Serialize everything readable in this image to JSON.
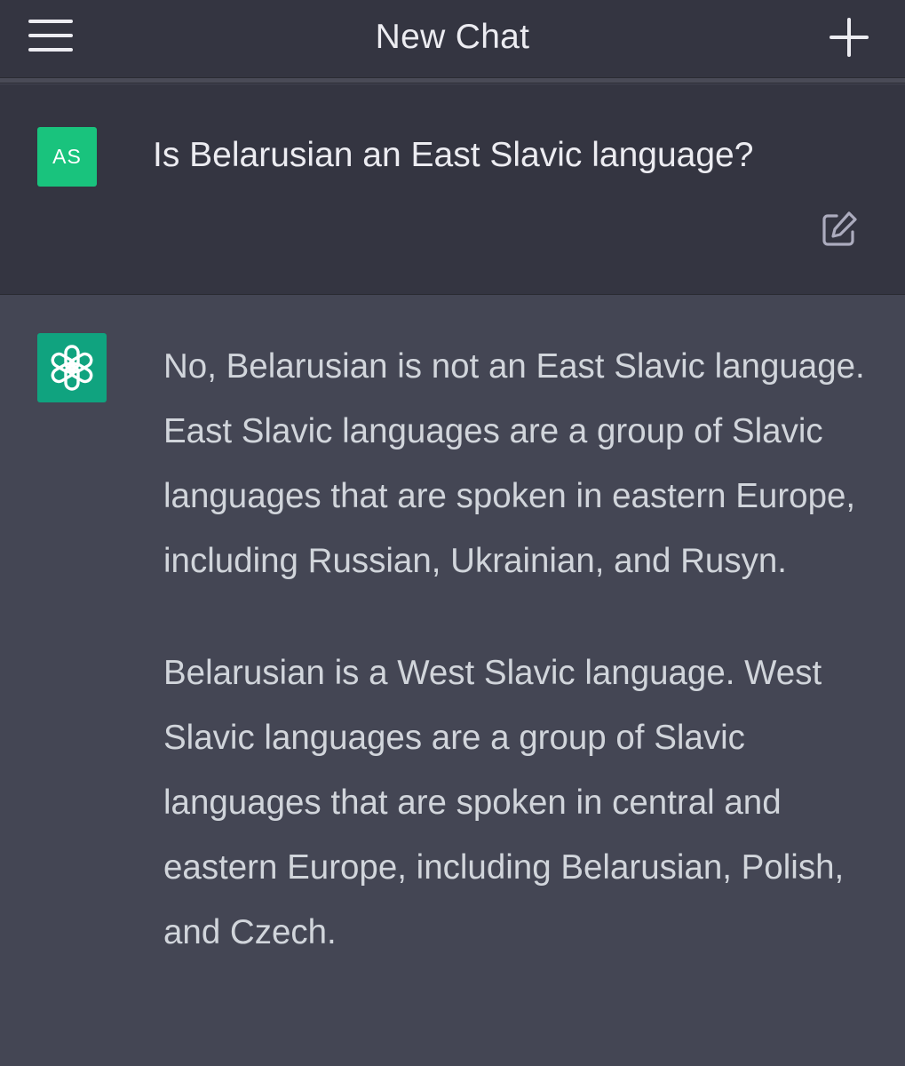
{
  "header": {
    "title": "New Chat",
    "menu_icon": "hamburger-menu-icon",
    "new_chat_icon": "plus-icon"
  },
  "user_message": {
    "avatar_initials": "AS",
    "text": "Is Belarusian an East Slavic language?",
    "edit_icon": "edit-icon"
  },
  "assistant_message": {
    "avatar_icon": "openai-logo-icon",
    "paragraphs": [
      "No, Belarusian is not an East Slavic language. East Slavic languages are a group of Slavic languages that are spoken in eastern Europe, including Russian, Ukrainian, and Rusyn.",
      "Belarusian is a West Slavic language. West Slavic languages are a group of Slavic languages that are spoken in central and eastern Europe, including Belarusian, Polish, and Czech."
    ]
  },
  "colors": {
    "header_bg": "#343541",
    "user_bg": "#343541",
    "assistant_bg": "#444654",
    "user_avatar": "#19c37d",
    "assistant_avatar": "#10a37f",
    "text_primary": "#ececf1",
    "text_assistant": "#d1d5db"
  }
}
